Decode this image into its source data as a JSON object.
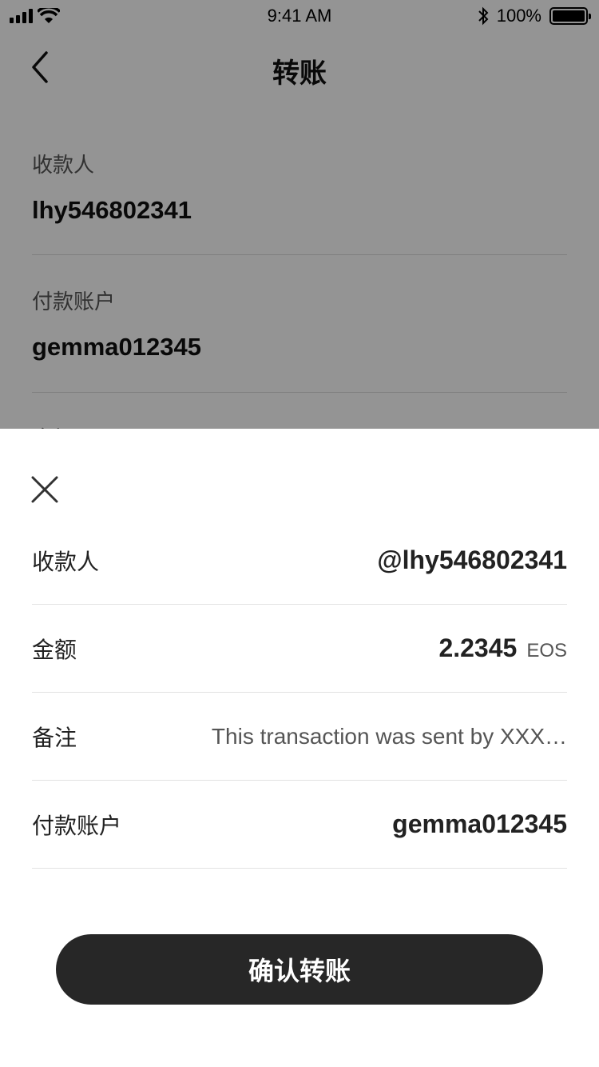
{
  "status_bar": {
    "time": "9:41 AM",
    "battery": "100%",
    "icons": [
      "signal-icon",
      "wifi-icon",
      "bluetooth-icon",
      "battery-icon"
    ]
  },
  "nav": {
    "title": "转账",
    "back_icon": "chevron-left-icon"
  },
  "form": {
    "recipient_label": "收款人",
    "recipient_value": "lhy546802341",
    "payer_label": "付款账户",
    "payer_value": "gemma012345",
    "amount_label_partial": "金额"
  },
  "sheet": {
    "close_icon": "close-icon",
    "rows": [
      {
        "label": "收款人",
        "value": "@lhy546802341"
      },
      {
        "label": "金额",
        "value": "2.2345",
        "unit": "EOS"
      },
      {
        "label": "备注",
        "value": "This transaction was sent by XXX…"
      },
      {
        "label": "付款账户",
        "value": "gemma012345"
      }
    ],
    "confirm_label": "确认转账"
  },
  "colors": {
    "overlay": "#000000",
    "button_bg": "#272727",
    "divider": "#e2e2e2"
  }
}
